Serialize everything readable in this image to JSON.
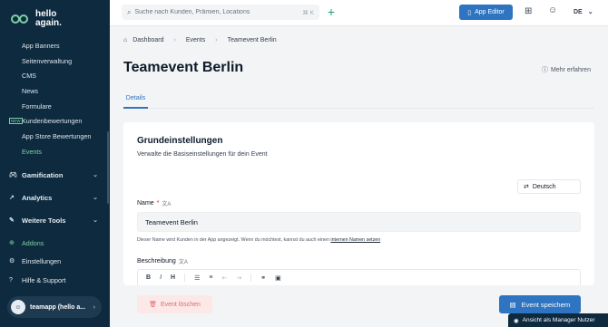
{
  "brand": {
    "logo_line1": "hello",
    "logo_line2": "again."
  },
  "sidebar": {
    "sub_items": [
      {
        "label": "App Banners",
        "active": false
      },
      {
        "label": "Seitenverwaltung",
        "active": false
      },
      {
        "label": "CMS",
        "active": false
      },
      {
        "label": "News",
        "active": false
      },
      {
        "label": "Formulare",
        "active": false
      },
      {
        "label": "Kundenbewertungen",
        "active": false,
        "badge": "NEW"
      },
      {
        "label": "App Store Bewertungen",
        "active": false
      },
      {
        "label": "Events",
        "active": true
      }
    ],
    "groups": [
      {
        "label": "Gamification"
      },
      {
        "label": "Analytics"
      },
      {
        "label": "Weitere Tools"
      }
    ],
    "links": [
      {
        "label": "Addons"
      },
      {
        "label": "Einstellungen"
      },
      {
        "label": "Hilfe & Support"
      }
    ],
    "user": {
      "name": "teamapp (hello a..."
    }
  },
  "topbar": {
    "search_placeholder": "Suche nach Kunden, Prämien, Locations",
    "search_shortcut": "⌘ K",
    "app_editor_label": "App Editor",
    "language": "DE"
  },
  "breadcrumb": {
    "items": [
      "Dashboard",
      "Events",
      "Teamevent Berlin"
    ]
  },
  "page": {
    "title": "Teamevent Berlin",
    "more_link": "Mehr erfahren",
    "tabs": [
      {
        "label": "Details",
        "active": true
      }
    ]
  },
  "card": {
    "title": "Grundeinstellungen",
    "subtitle": "Verwalte die Basiseinstellungen für dein Event",
    "language_select": "Deutsch",
    "name_label": "Name",
    "name_required": "*",
    "name_value": "Teamevent Berlin",
    "name_hint": "Dieser Name wird Kunden in der App angezeigt. Wenn du möchtest, kannst du auch einen",
    "name_hint_link": "internen Namen setzen",
    "description_label": "Beschreibung"
  },
  "actions": {
    "delete_label": "Event löschen",
    "save_label": "Event speichern",
    "manager_view_label": "Ansicht als Manager Nutzer"
  },
  "colors": {
    "primary": "#2f74c0",
    "sidebar_bg": "#0d2a3f",
    "accent_green": "#7fd0a6"
  }
}
